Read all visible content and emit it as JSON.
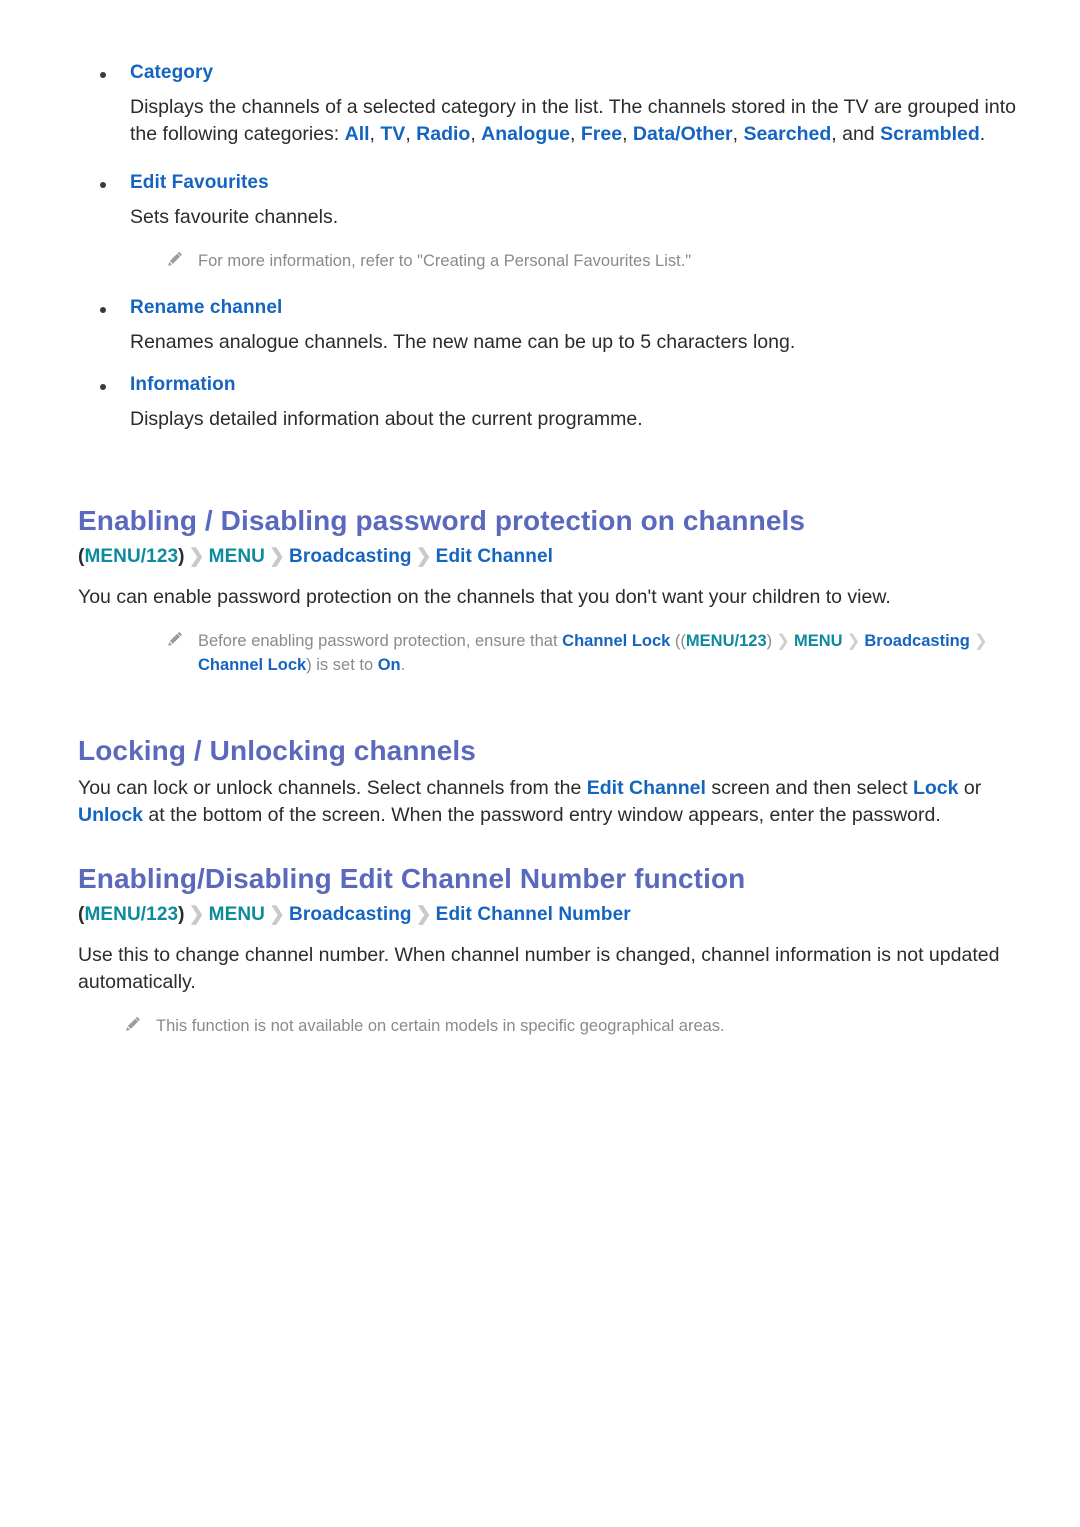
{
  "bullets": [
    {
      "label": "Category",
      "body_lead": "Displays the channels of a selected category in the list. The channels stored in the TV are grouped into the following categories: ",
      "categories": [
        "All",
        "TV",
        "Radio",
        "Analogue",
        "Free",
        "Data/Other",
        "Searched"
      ],
      "body_join": ", and ",
      "last_category": "Scrambled",
      "body_tail": "."
    },
    {
      "label": "Edit Favourites",
      "body": "Sets favourite channels."
    },
    {
      "label": "Rename channel",
      "body": "Renames analogue channels. The new name can be up to 5 characters long."
    },
    {
      "label": "Information",
      "body": "Displays detailed information about the current programme."
    }
  ],
  "favourites_note": "For more information, refer to \"Creating a Personal Favourites List.\"",
  "sections": [
    {
      "heading": "Enabling / Disabling password protection on channels",
      "breadcrumb": {
        "open_paren": "(",
        "menu123": "MENU/123",
        "close_paren": ")",
        "menu": "MENU",
        "broadcasting": "Broadcasting",
        "leaf": "Edit Channel",
        "chevron": "〉"
      },
      "paragraph": "You can enable password protection on the channels that you don't want your children to view.",
      "note": {
        "lead": "Before enabling password protection, ensure that ",
        "term": "Channel Lock",
        "open": " ((",
        "menu123": "MENU/123",
        "close1": ")",
        "menu": "MENU",
        "broadcasting": "Broadcasting",
        "leaf": "Channel Lock",
        "close2": ") is set to ",
        "value": "On",
        "tail": "."
      }
    },
    {
      "heading": "Locking / Unlocking channels",
      "paragraph_parts": {
        "p1": "You can lock or unlock channels. Select channels from the ",
        "t1": "Edit Channel",
        "p2": " screen and then select ",
        "t2": "Lock",
        "p3": " or ",
        "t3": "Unlock",
        "p4": " at the bottom of the screen. When the password entry window appears, enter the password."
      }
    },
    {
      "heading": "Enabling/Disabling Edit Channel Number function",
      "breadcrumb": {
        "open_paren": "(",
        "menu123": "MENU/123",
        "close_paren": ")",
        "menu": "MENU",
        "broadcasting": "Broadcasting",
        "leaf": "Edit Channel Number",
        "chevron": "〉"
      },
      "paragraph": "Use this to change channel number. When channel number is changed, channel information is not updated automatically.",
      "note_text": "This function is not available on certain models in specific geographical areas."
    }
  ],
  "colors": {
    "heading": "#5b69bd",
    "link": "#1565c0",
    "teal": "#0d8a9e",
    "body": "#2b2b2b",
    "note": "#8a8a8a",
    "chevron": "#c9c9c9"
  }
}
